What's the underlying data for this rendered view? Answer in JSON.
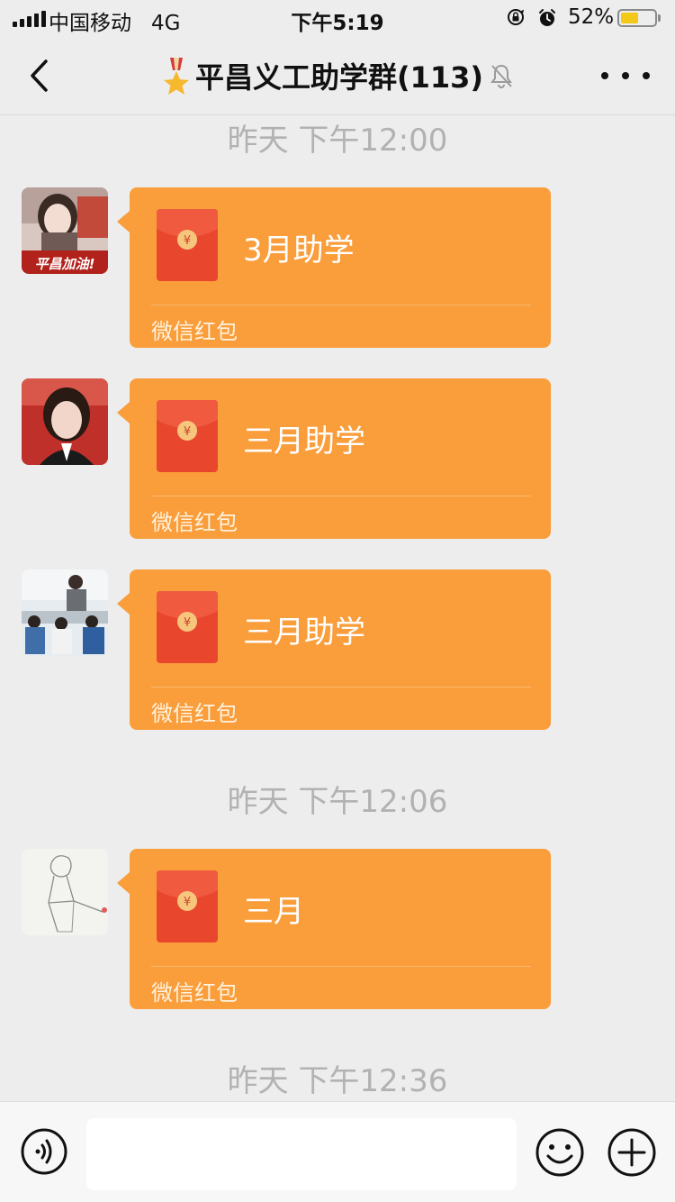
{
  "status_bar": {
    "carrier": "中国移动",
    "network": "4G",
    "time": "下午5:19",
    "battery_percent": "52%",
    "battery_level": 0.52,
    "battery_color": "#f3c816",
    "icons": [
      "signal-icon",
      "orientation-lock-icon",
      "alarm-icon",
      "battery-icon"
    ]
  },
  "nav": {
    "back_icon": "chevron-left-icon",
    "title_icon": "medal-icon",
    "title": "平昌义工助学群(113)",
    "mute_icon": "bell-mute-icon",
    "more_icon": "more-dots-icon"
  },
  "messages": [
    {
      "type": "timestamp",
      "text": "昨天 下午12:00"
    },
    {
      "type": "red_packet",
      "avatar": "avatar-girl-with-banner",
      "avatar_text": "平昌加油!",
      "title": "3月助学",
      "footer": "微信红包"
    },
    {
      "type": "red_packet",
      "avatar": "avatar-woman-portrait",
      "title": "三月助学",
      "footer": "微信红包"
    },
    {
      "type": "red_packet",
      "avatar": "avatar-classroom-photo",
      "title": "三月助学",
      "footer": "微信红包"
    },
    {
      "type": "timestamp",
      "text": "昨天 下午12:06"
    },
    {
      "type": "red_packet",
      "avatar": "avatar-sketch-boy",
      "title": "三月",
      "footer": "微信红包"
    },
    {
      "type": "timestamp",
      "text": "昨天 下午12:36"
    }
  ],
  "colors": {
    "red_packet_bg": "#fa9d3b",
    "envelope_red": "#e8472e",
    "coin": "#f6c67c",
    "chat_bg": "#ededed"
  },
  "input_bar": {
    "voice_icon": "voice-icon",
    "input_value": "",
    "emoji_icon": "emoji-icon",
    "plus_icon": "plus-icon"
  }
}
